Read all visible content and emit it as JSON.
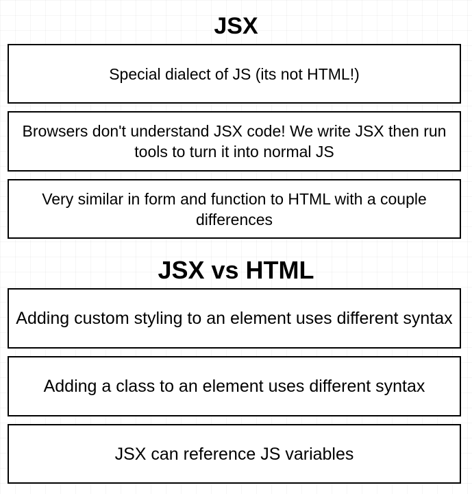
{
  "section1": {
    "title": "JSX",
    "boxes": [
      "Special dialect of JS (its not HTML!)",
      "Browsers don't understand JSX code!  We write JSX then run tools to turn it into normal JS",
      "Very similar in form and function to HTML with a couple differences"
    ]
  },
  "section2": {
    "title": "JSX vs HTML",
    "boxes": [
      "Adding custom styling to an element uses different syntax",
      "Adding a class to an element uses different syntax",
      "JSX can reference JS variables"
    ]
  }
}
